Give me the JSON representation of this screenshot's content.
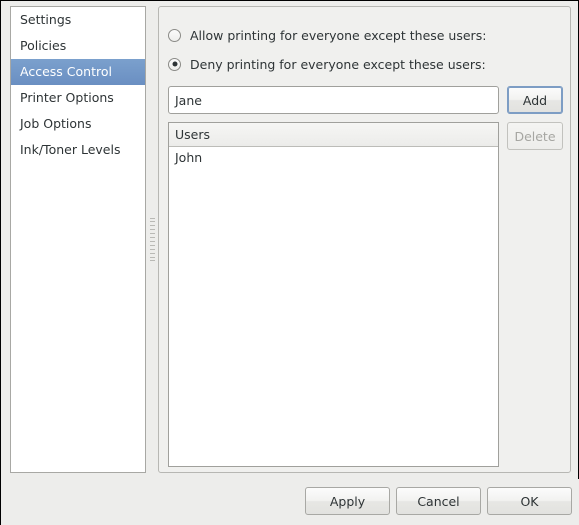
{
  "sidebar": {
    "items": [
      {
        "label": "Settings",
        "selected": false
      },
      {
        "label": "Policies",
        "selected": false
      },
      {
        "label": "Access Control",
        "selected": true
      },
      {
        "label": "Printer Options",
        "selected": false
      },
      {
        "label": "Job Options",
        "selected": false
      },
      {
        "label": "Ink/Toner Levels",
        "selected": false
      }
    ]
  },
  "access_control": {
    "allow_option_label": "Allow printing for everyone except these users:",
    "deny_option_label": "Deny printing for everyone except these users:",
    "selected_option": "deny",
    "user_entry": {
      "value": "Jane",
      "placeholder": ""
    },
    "add_button_label": "Add",
    "delete_button_label": "Delete",
    "delete_button_enabled": false,
    "users_list": {
      "header": "Users",
      "rows": [
        "John"
      ]
    }
  },
  "actions": {
    "apply_label": "Apply",
    "cancel_label": "Cancel",
    "ok_label": "OK"
  },
  "colors": {
    "selection_blue": "#6a8fc2",
    "focus_blue": "#7d9dc4",
    "window_bg": "#ededeb",
    "panel_bg": "#f0f0ee",
    "text": "#2e3436",
    "disabled_text": "#a6a6a2"
  }
}
